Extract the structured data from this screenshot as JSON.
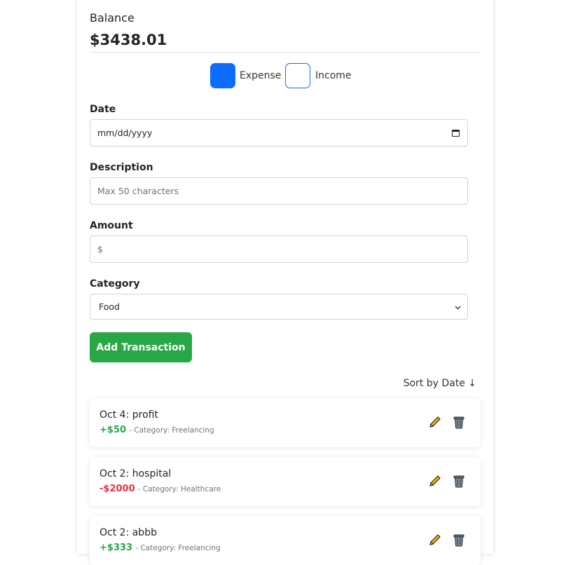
{
  "balance": {
    "label": "Balance",
    "value": "$3438.01"
  },
  "type_toggle": {
    "expense_label": "Expense",
    "income_label": "Income",
    "selected": "Expense",
    "accent_color": "#0d6efd"
  },
  "form": {
    "date": {
      "label": "Date",
      "placeholder": "mm/dd/yyyy"
    },
    "description": {
      "label": "Description",
      "placeholder": "Max 50 characters"
    },
    "amount": {
      "label": "Amount",
      "placeholder": "$"
    },
    "category": {
      "label": "Category",
      "selected": "Food"
    }
  },
  "add_button": {
    "label": "Add Transaction",
    "color": "#28a745"
  },
  "sort": {
    "label": "Sort by Date ↓"
  },
  "transactions": [
    {
      "title": "Oct 4: profit",
      "amount": "+$50",
      "category": "- Category: Freelancing",
      "kind": "income"
    },
    {
      "title": "Oct 2: hospital",
      "amount": "-$2000",
      "category": "- Category: Healthcare",
      "kind": "expense"
    },
    {
      "title": "Oct 2: abbb",
      "amount": "+$333",
      "category": "- Category: Freelancing",
      "kind": "income"
    }
  ],
  "colors": {
    "income": "#28a745",
    "expense": "#dc3545"
  }
}
